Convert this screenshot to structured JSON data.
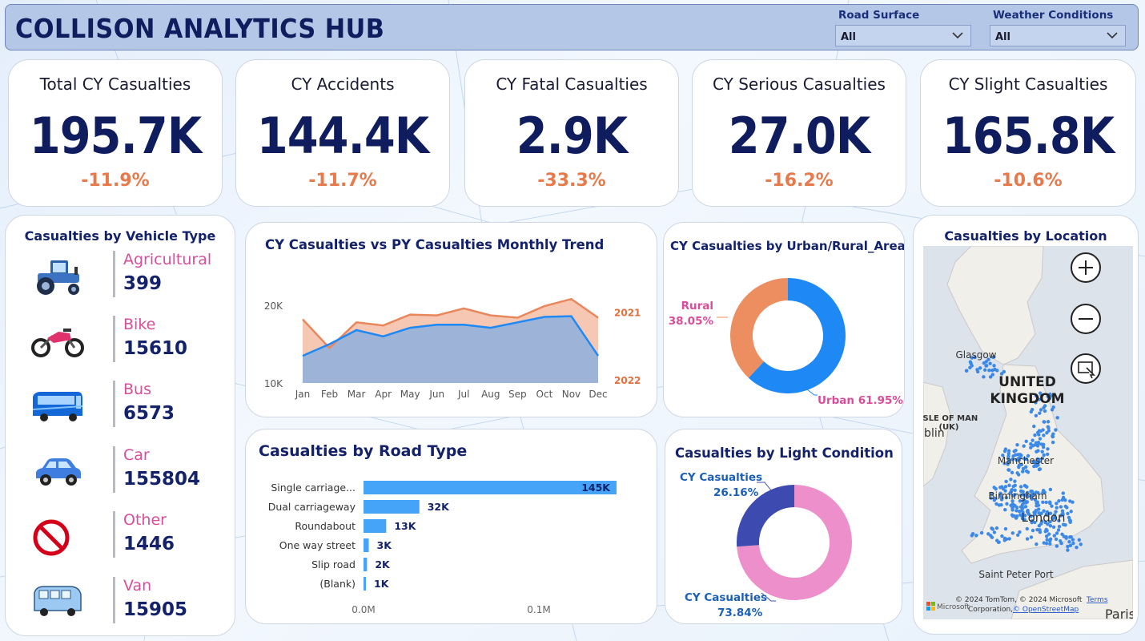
{
  "header": {
    "title": "COLLISON ANALYTICS HUB",
    "filters": [
      {
        "label": "Road Surface",
        "value": "All"
      },
      {
        "label": "Weather Conditions",
        "value": "All"
      }
    ]
  },
  "kpis": [
    {
      "title": "Total CY Casualties",
      "value": "195.7K",
      "delta": "-11.9%"
    },
    {
      "title": "CY Accidents",
      "value": "144.4K",
      "delta": "-11.7%"
    },
    {
      "title": "CY Fatal Casualties",
      "value": "2.9K",
      "delta": "-33.3%"
    },
    {
      "title": "CY Serious Casualties",
      "value": "27.0K",
      "delta": "-16.2%"
    },
    {
      "title": "CY Slight Casualties",
      "value": "165.8K",
      "delta": "-10.6%"
    }
  ],
  "vehicle_type": {
    "title": "Casualties by Vehicle Type",
    "items": [
      {
        "name": "Agricultural",
        "value": "399",
        "icon": "tractor-icon"
      },
      {
        "name": "Bike",
        "value": "15610",
        "icon": "motorbike-icon"
      },
      {
        "name": "Bus",
        "value": "6573",
        "icon": "bus-icon"
      },
      {
        "name": "Car",
        "value": "155804",
        "icon": "car-icon"
      },
      {
        "name": "Other",
        "value": "1446",
        "icon": "no-entry-icon"
      },
      {
        "name": "Van",
        "value": "15905",
        "icon": "van-icon"
      }
    ]
  },
  "location": {
    "title": "Casualties by Location",
    "labels": [
      "Glasgow",
      "UNITED",
      "KINGDOM",
      "ISLE OF MAN",
      "(UK)",
      "Dublin",
      "Manchester",
      "Birmingham",
      "London",
      "Saint Peter Port",
      "Paris"
    ],
    "attribution": [
      "© 2024 TomTom, © 2024 Microsoft",
      "Corporation,",
      "© OpenStreetMap",
      "Terms"
    ],
    "logo": "Microsoft",
    "buttons": [
      "zoom-in-icon",
      "zoom-out-icon",
      "select-area-icon"
    ]
  },
  "colors": {
    "navy": "#0f1d5e",
    "pink": "#d94d9a",
    "orange": "#e8794a",
    "blue": "#1e88f5",
    "bar_blue": "#45a4f7",
    "donut_pink": "#ec8fca",
    "donut_indigo": "#3d4bb0",
    "donut_orange": "#ec8e5f"
  },
  "chart_data": [
    {
      "type": "area",
      "title": "CY Casualties vs PY Casualties Monthly Trend",
      "categories": [
        "Jan",
        "Feb",
        "Mar",
        "Apr",
        "May",
        "Jun",
        "Jul",
        "Aug",
        "Sep",
        "Oct",
        "Nov",
        "Dec"
      ],
      "y_ticks": [
        "10K",
        "20K"
      ],
      "ylim": [
        10000,
        21500
      ],
      "series": [
        {
          "name": "2021",
          "values": [
            18200,
            14500,
            17800,
            17400,
            18800,
            18700,
            19600,
            18700,
            18400,
            19900,
            20800,
            18400
          ]
        },
        {
          "name": "2022",
          "values": [
            13500,
            15000,
            16800,
            16000,
            17100,
            17500,
            17500,
            17100,
            17800,
            18500,
            18600,
            13500
          ]
        }
      ]
    },
    {
      "type": "pie",
      "title": "CY Casualties by Urban/Rural_Area",
      "categories": [
        "Urban",
        "Rural"
      ],
      "values": [
        61.95,
        38.05
      ],
      "labels": [
        "Urban 61.95%",
        "Rural",
        "38.05%"
      ]
    },
    {
      "type": "bar",
      "title": "Casualties by Road Type",
      "categories": [
        "Single carriage...",
        "Dual carriageway",
        "Roundabout",
        "One way street",
        "Slip road",
        "(Blank)"
      ],
      "values": [
        145000,
        32000,
        13000,
        3000,
        2000,
        1000
      ],
      "data_labels": [
        "145K",
        "32K",
        "13K",
        "3K",
        "2K",
        "1K"
      ],
      "x_ticks": [
        "0.0M",
        "0.1M"
      ],
      "xlim": [
        0,
        145000
      ]
    },
    {
      "type": "pie",
      "title": "Casualties by Light Condition",
      "categories": [
        "CY Casualties",
        "CY Casualties"
      ],
      "values": [
        73.84,
        26.16
      ],
      "labels": [
        "CY Casualties",
        "73.84%",
        "CY Casualties",
        "26.16%"
      ]
    }
  ]
}
